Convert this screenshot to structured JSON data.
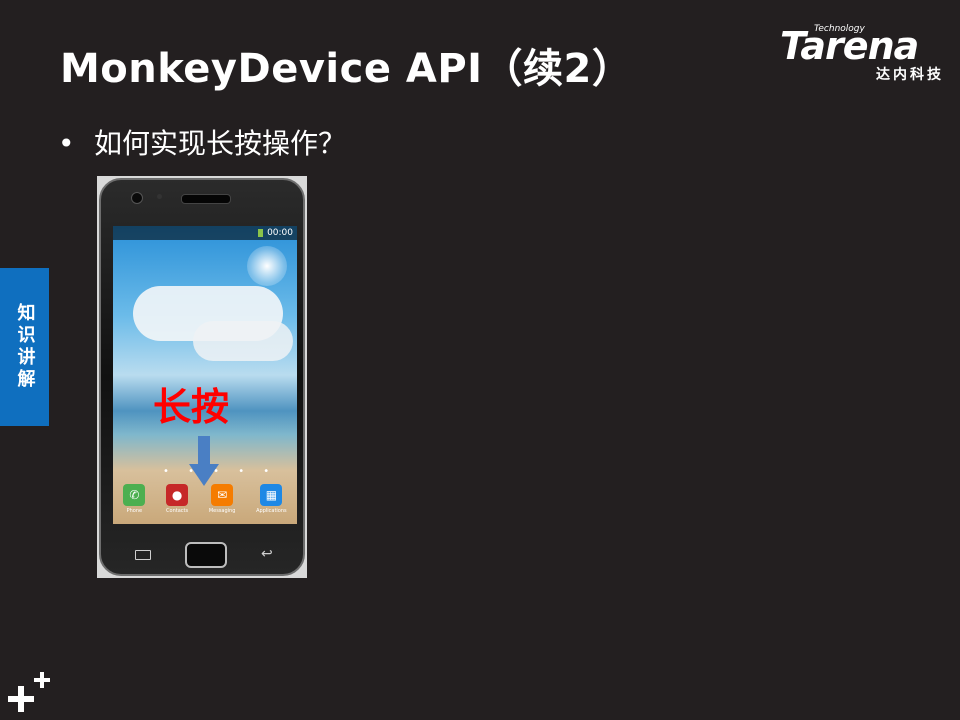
{
  "slide": {
    "title": "MonkeyDevice API（续2）",
    "bullet": "如何实现长按操作？",
    "side_tab": "知识讲解"
  },
  "logo": {
    "tagline": "Technology",
    "wordmark": "Tarena",
    "subtitle": "达内科技"
  },
  "phone_screen": {
    "status_time": "00:00",
    "overlay_text": "长按",
    "dock": [
      {
        "label": "Phone",
        "color": "#4caf50",
        "icon": "phone-icon"
      },
      {
        "label": "Contacts",
        "color": "#c62828",
        "icon": "contacts-icon"
      },
      {
        "label": "Messaging",
        "color": "#f57c00",
        "icon": "messaging-icon"
      },
      {
        "label": "Applications",
        "color": "#1e88e5",
        "icon": "apps-grid-icon"
      }
    ]
  },
  "colors": {
    "background": "#231f20",
    "side_tab": "#0f6fbf",
    "overlay_text": "#ff0000",
    "arrow": "#4a7fc4"
  }
}
